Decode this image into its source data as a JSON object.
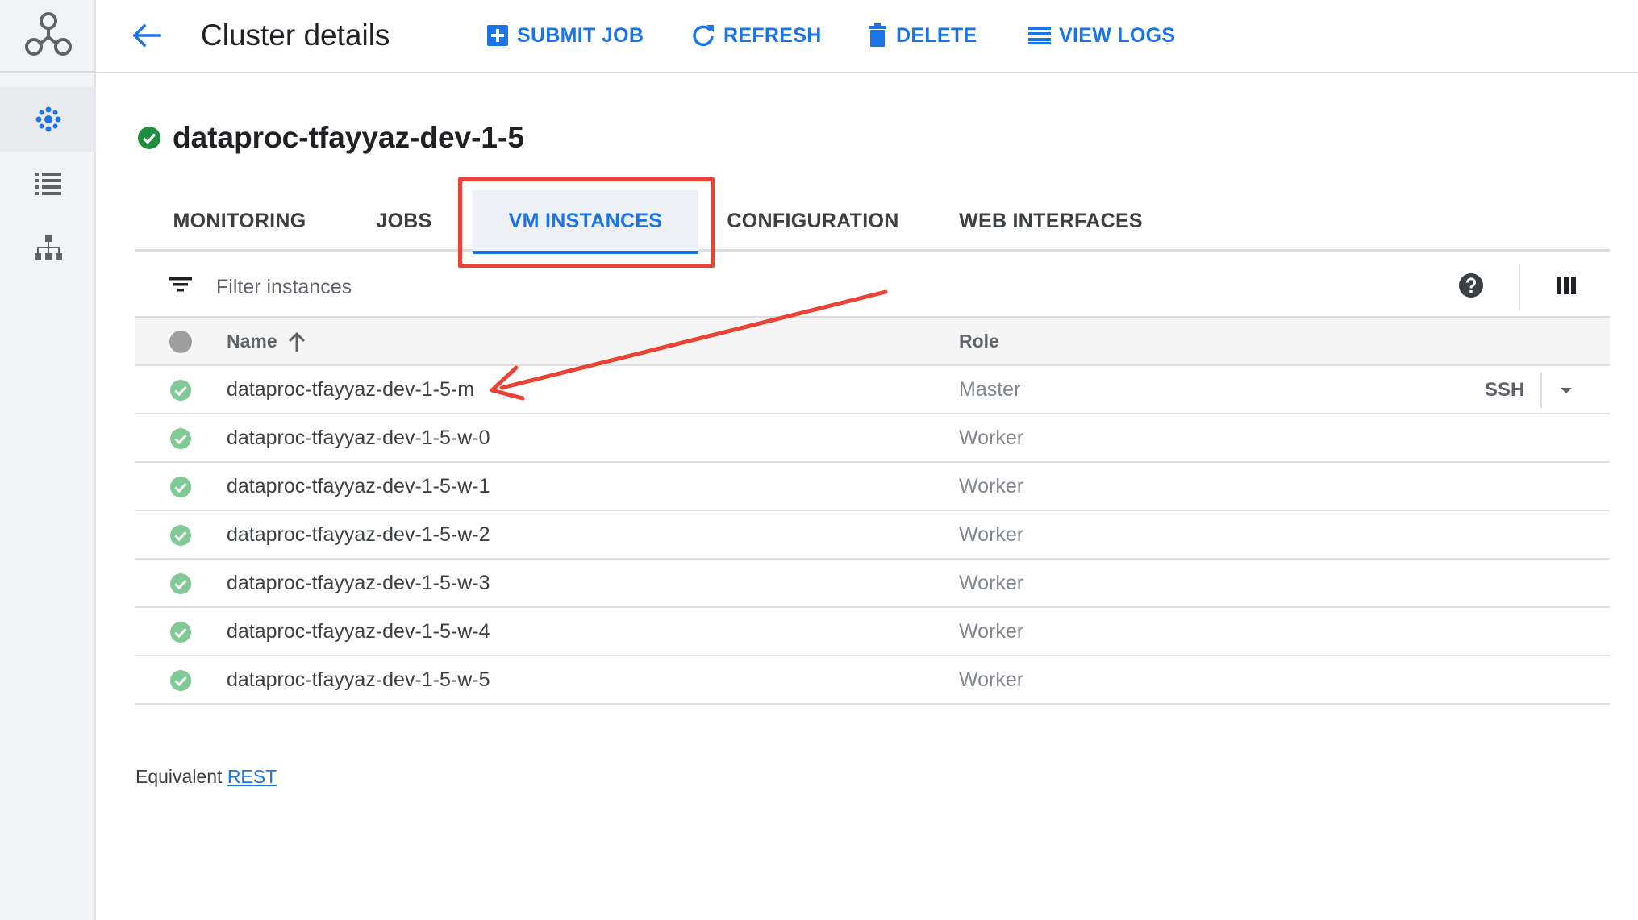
{
  "header": {
    "title": "Cluster details",
    "actions": [
      {
        "label": "SUBMIT JOB",
        "icon": "add-box-icon"
      },
      {
        "label": "REFRESH",
        "icon": "refresh-icon"
      },
      {
        "label": "DELETE",
        "icon": "trash-icon"
      },
      {
        "label": "VIEW LOGS",
        "icon": "list-icon"
      }
    ]
  },
  "rail": {
    "items": [
      {
        "icon": "dataproc-logo-icon"
      },
      {
        "icon": "clusters-icon",
        "active": true
      },
      {
        "icon": "jobs-list-icon"
      },
      {
        "icon": "workflows-icon"
      }
    ]
  },
  "cluster": {
    "name": "dataproc-tfayyaz-dev-1-5",
    "status": "running"
  },
  "tabs": [
    {
      "label": "MONITORING"
    },
    {
      "label": "JOBS"
    },
    {
      "label": "VM INSTANCES",
      "active": true
    },
    {
      "label": "CONFIGURATION"
    },
    {
      "label": "WEB INTERFACES"
    }
  ],
  "filter": {
    "placeholder": "Filter instances"
  },
  "table": {
    "columns": {
      "name": "Name",
      "role": "Role"
    },
    "rows": [
      {
        "name": "dataproc-tfayyaz-dev-1-5-m",
        "role": "Master",
        "ssh": "SSH"
      },
      {
        "name": "dataproc-tfayyaz-dev-1-5-w-0",
        "role": "Worker"
      },
      {
        "name": "dataproc-tfayyaz-dev-1-5-w-1",
        "role": "Worker"
      },
      {
        "name": "dataproc-tfayyaz-dev-1-5-w-2",
        "role": "Worker"
      },
      {
        "name": "dataproc-tfayyaz-dev-1-5-w-3",
        "role": "Worker"
      },
      {
        "name": "dataproc-tfayyaz-dev-1-5-w-4",
        "role": "Worker"
      },
      {
        "name": "dataproc-tfayyaz-dev-1-5-w-5",
        "role": "Worker"
      }
    ]
  },
  "footer": {
    "prefix": "Equivalent",
    "link": "REST"
  },
  "colors": {
    "accent": "#1a73e8",
    "success": "#1e8e3e",
    "annotation": "#ea4335"
  }
}
